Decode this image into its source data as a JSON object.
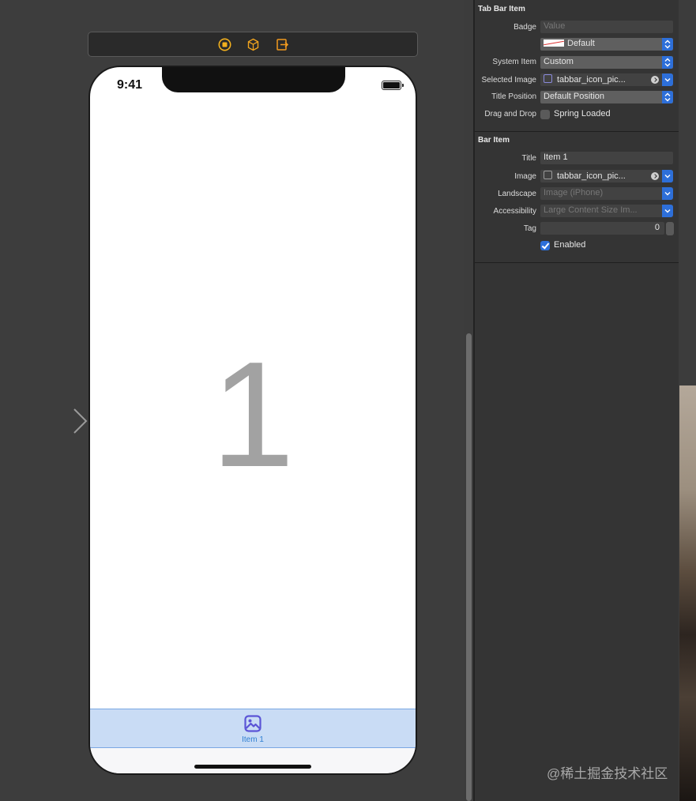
{
  "phone": {
    "time": "9:41",
    "big_number": "1",
    "tab_item_label": "Item 1"
  },
  "inspector": {
    "tab_bar_item": {
      "section_title": "Tab Bar Item",
      "badge_label": "Badge",
      "badge_placeholder": "Value",
      "badge_color_value": "Default",
      "system_item_label": "System Item",
      "system_item_value": "Custom",
      "selected_image_label": "Selected Image",
      "selected_image_value": "tabbar_icon_pic...",
      "title_position_label": "Title Position",
      "title_position_value": "Default Position",
      "drag_drop_label": "Drag and Drop",
      "spring_loaded_label": "Spring Loaded",
      "spring_loaded_checked": false
    },
    "bar_item": {
      "section_title": "Bar Item",
      "title_label": "Title",
      "title_value": "Item 1",
      "image_label": "Image",
      "image_value": "tabbar_icon_pic...",
      "landscape_label": "Landscape",
      "landscape_placeholder": "Image (iPhone)",
      "accessibility_label": "Accessibility",
      "accessibility_placeholder": "Large Content Size Im...",
      "tag_label": "Tag",
      "tag_value": "0",
      "enabled_label": "Enabled",
      "enabled_checked": true
    }
  },
  "watermark": "@稀土掘金技术社区",
  "colors": {
    "accent": "#2d6fd9",
    "tabbar_selected_bg": "#c9dcf5",
    "tab_tint": "#5b54d6"
  }
}
